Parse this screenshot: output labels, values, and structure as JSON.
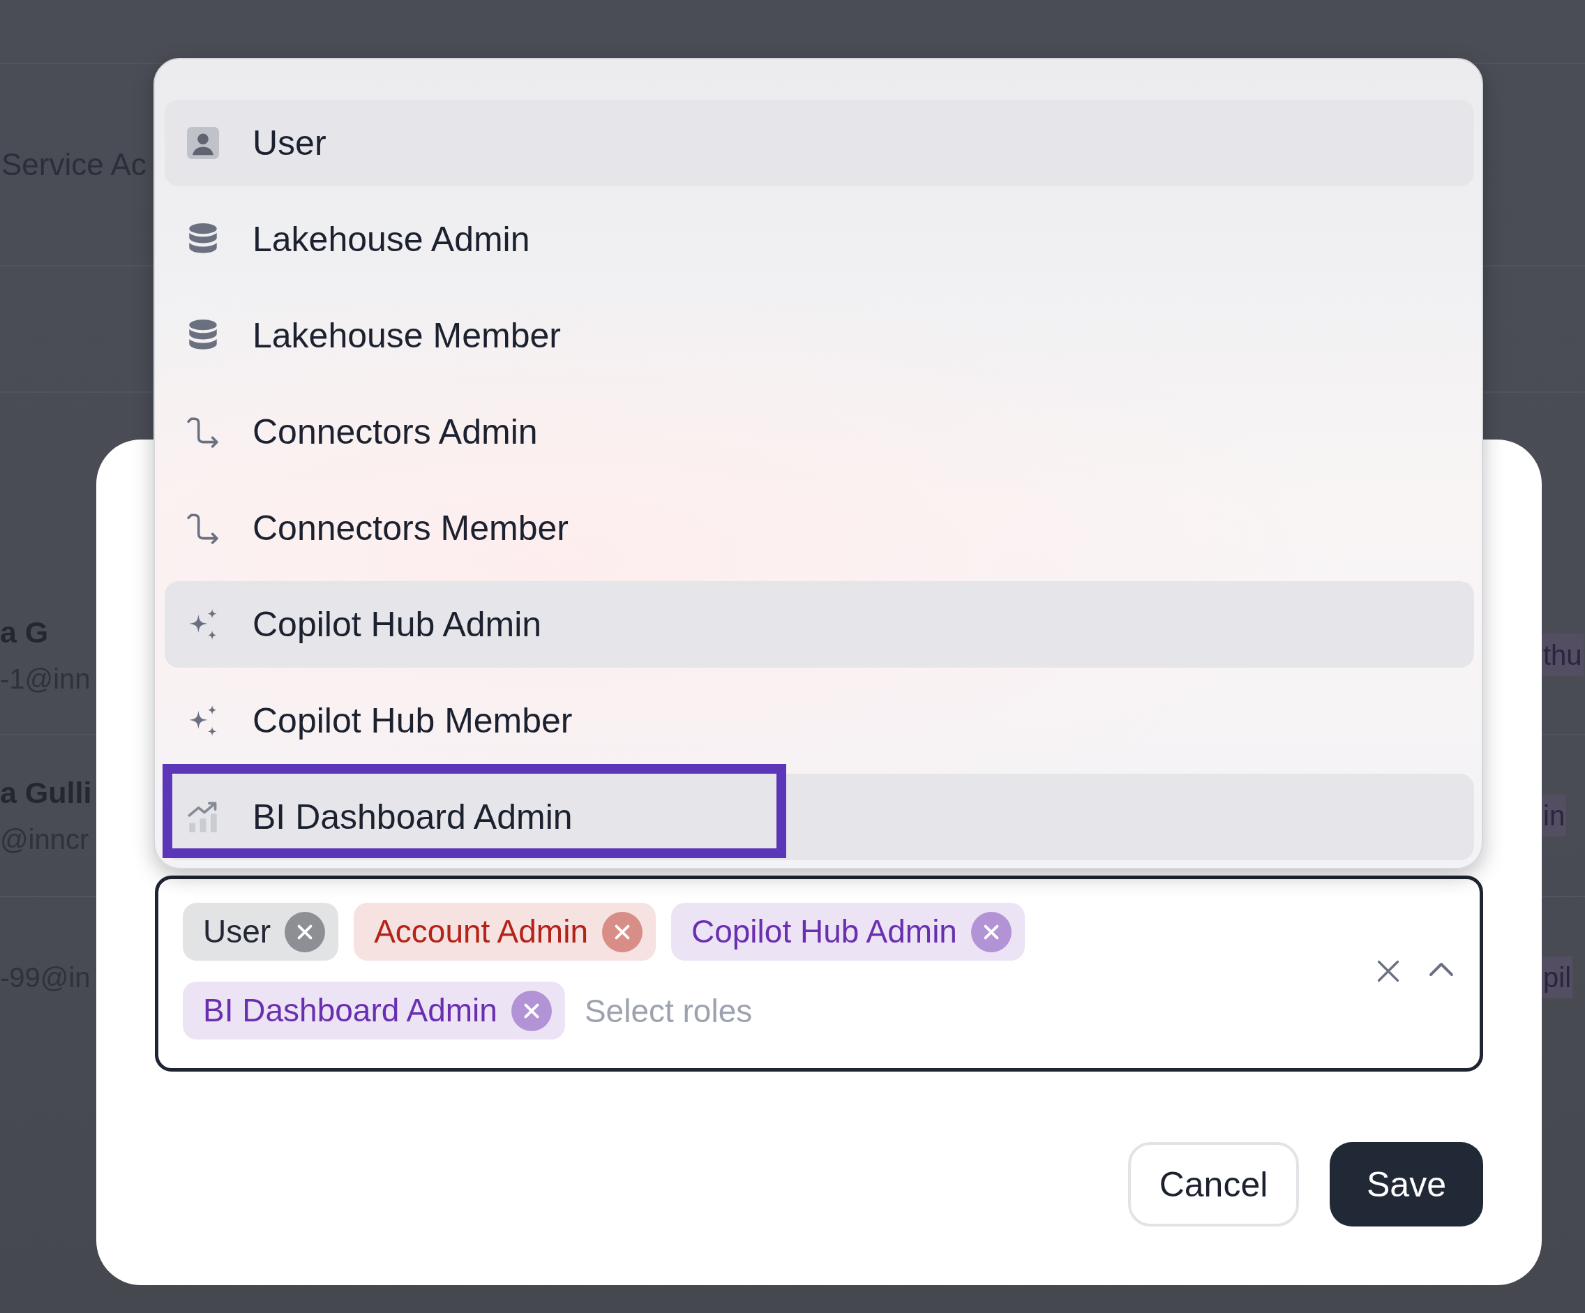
{
  "background_page": {
    "heading": "Service Ac",
    "rows": [
      {
        "name": "a G",
        "email": "-1@inn",
        "role": "thu"
      },
      {
        "name": "a Gulli",
        "email": "@inncr",
        "role": "in"
      },
      {
        "email": "-99@in",
        "role": "pil"
      }
    ]
  },
  "role_menu": {
    "options": [
      {
        "label": "User",
        "kind": "user",
        "selected": true,
        "focused": false
      },
      {
        "label": "Lakehouse Admin",
        "kind": "lakehouse",
        "selected": false,
        "focused": false
      },
      {
        "label": "Lakehouse Member",
        "kind": "lakehouse",
        "selected": false,
        "focused": false
      },
      {
        "label": "Connectors Admin",
        "kind": "connector",
        "selected": false,
        "focused": false
      },
      {
        "label": "Connectors Member",
        "kind": "connector",
        "selected": false,
        "focused": false
      },
      {
        "label": "Copilot Hub Admin",
        "kind": "copilot",
        "selected": true,
        "focused": false
      },
      {
        "label": "Copilot Hub Member",
        "kind": "copilot",
        "selected": false,
        "focused": false
      },
      {
        "label": "BI Dashboard Admin",
        "kind": "dashboard",
        "selected": true,
        "focused": true
      }
    ]
  },
  "dialog": {
    "role_select": {
      "selected_roles": [
        {
          "label": "User",
          "color": "#232834"
        },
        {
          "label": "Account Admin",
          "color": "#b42318"
        },
        {
          "label": "Copilot Hub Admin",
          "color": "#6a2fb0"
        },
        {
          "label": "BI Dashboard Admin",
          "color": "#6a2fb0"
        }
      ],
      "placeholder": "Select roles"
    },
    "buttons": [
      {
        "label": "Cancel",
        "kind": "secondary"
      },
      {
        "label": "Save",
        "kind": "primary"
      }
    ]
  }
}
